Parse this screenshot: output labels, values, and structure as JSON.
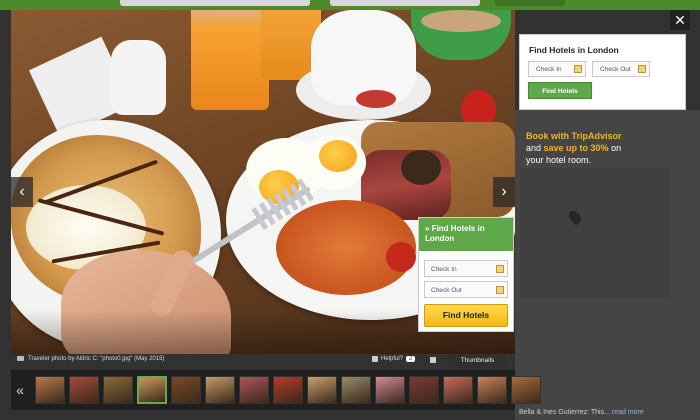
{
  "page": {
    "credit": "Traveler photo by Aldric C: \"photo0.jpg\" (May 2015)",
    "helpful_label": "Helpful?",
    "helpful_count": "2",
    "thumbnails_tab": "Thumbnails",
    "close_symbol": "✕",
    "prev_symbol": "‹",
    "next_symbol": "›",
    "strip_prev": "«",
    "strip_next": "»"
  },
  "hotel_panel": {
    "title": "Find Hotels in London",
    "check_in": "Check In",
    "check_out": "Check Out",
    "button": "Find Hotels"
  },
  "promo": {
    "line1_highlight": "Book with TripAdvisor",
    "line2_prefix": "and ",
    "line2_highlight": "save up to 30%",
    "line2_suffix": " on",
    "line3": "your hotel room."
  },
  "inline_panel": {
    "title": "Find Hotels in London",
    "arrow": "»",
    "check_in": "Check In",
    "check_out": "Check Out",
    "button": "Find Hotels"
  },
  "review_snippet": {
    "text": "Bella & Ines Gutierrez: This... ",
    "link": "read more"
  },
  "filmstrip": {
    "colors": [
      "#b87a4a",
      "#a84a3a",
      "#8a6a3a",
      "#c89a5a",
      "#7a4a2a",
      "#c49a6a",
      "#b0545a",
      "#b83a2a",
      "#c8a070",
      "#9a8a6a",
      "#d4889a",
      "#7a3a3a",
      "#c96a5a",
      "#c8825a",
      "#a86a3a"
    ],
    "active_index": 3
  },
  "colors": {
    "accent_green": "#5fa84a",
    "accent_yellow": "#f2b521"
  }
}
